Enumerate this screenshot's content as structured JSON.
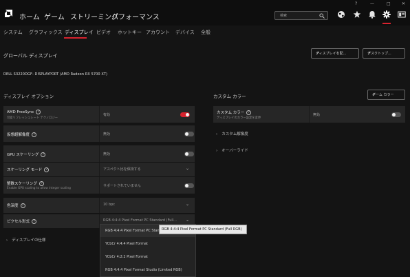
{
  "nav": {
    "items": [
      "ホーム",
      "ゲーム",
      "ストリーミング",
      "パフォーマンス"
    ]
  },
  "search": {
    "placeholder": "検索"
  },
  "icons": {
    "logo": "amd-logo-icon",
    "search": "search-icon",
    "web": "globe-icon",
    "favorite": "star-icon",
    "notifications": "bell-icon",
    "settings": "gear-icon",
    "profile": "monitor-icon"
  },
  "window": {
    "help": "?",
    "minimize": "—",
    "maximize": "□",
    "close": "✕"
  },
  "tabs": [
    "システム",
    "グラフィックス",
    "ディスプレイ",
    "ビデオ",
    "ホットキー",
    "アカウント",
    "デバイス",
    "全般"
  ],
  "active_tab": "ディスプレイ",
  "page": {
    "title": "グローバル ディスプレイ",
    "btn_display_settings": "ディスプレイを配...",
    "btn_desktop": "デスクトップ...",
    "device": "DELL S3220DGF- DISPLAYPORT (AMD Radeon RX 5700 XT)"
  },
  "display_options": {
    "title": "ディスプレイ オプション",
    "rows": [
      {
        "label": "AMD FreeSync",
        "sub": "可変リフレッシュレート テクノロジー",
        "value": "有効",
        "toggle": "on"
      },
      {
        "label": "仮想超解像度",
        "value": "無効",
        "toggle": "off"
      },
      {
        "label": "GPU スケーリング",
        "value": "無効",
        "toggle": "off"
      },
      {
        "label": "スケーリング モード",
        "value": "アスペクト比を保持する",
        "control": "dropdown"
      },
      {
        "label": "整数スケーリング",
        "sub": "Enable GPU scaling to allow integer scaling",
        "value": "サポートされていません",
        "toggle": "off"
      },
      {
        "label": "色深度",
        "value": "10 bpc",
        "control": "dropdown"
      },
      {
        "label": "ピクセル形式",
        "value": "RGB 4:4:4 Pixel Format PC Standard (Full...",
        "control": "dropdown"
      }
    ],
    "expander": "ディスプレイの仕様"
  },
  "custom_color": {
    "title": "カスタム カラー",
    "game_color_btn": "ゲーム カラー",
    "row": {
      "label": "カスタム カラー",
      "sub": "ディスプレイのカラー設定を変更",
      "value": "無効",
      "toggle": "off"
    },
    "expanders": [
      "カスタム解像度",
      "オーバーライド"
    ]
  },
  "pixel_format_dropdown": {
    "options": [
      "RGB 4:4:4 Pixel Format PC Standard (Full RGB)",
      "YCbCr 4:4:4 Pixel Format",
      "YCbCr 4:2:2 Pixel Format",
      "RGB 4:4:4 Pixel Format Studio (Limited RGB)"
    ],
    "tooltip": "RGB 4:4:4 Pixel Format PC Standard (Full RGB)"
  },
  "colors": {
    "accent": "#d8222e",
    "background": "#141414",
    "row": "#262626"
  }
}
